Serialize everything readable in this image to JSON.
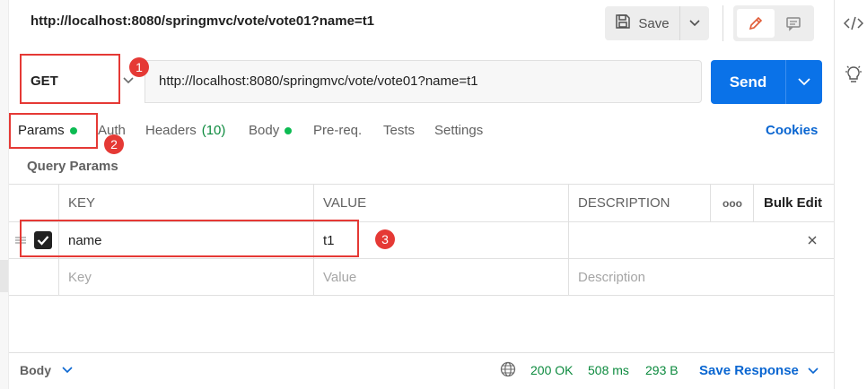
{
  "header": {
    "url_title": "http://localhost:8080/springmvc/vote/vote01?name=t1",
    "save_label": "Save"
  },
  "request": {
    "method": "GET",
    "url": "http://localhost:8080/springmvc/vote/vote01?name=t1",
    "send_label": "Send"
  },
  "tabs": {
    "params": "Params",
    "auth": "Auth",
    "headers": "Headers",
    "headers_count": "(10)",
    "body": "Body",
    "prereq": "Pre-req.",
    "tests": "Tests",
    "settings": "Settings",
    "cookies": "Cookies"
  },
  "query_params": {
    "title": "Query Params",
    "columns": {
      "key": "KEY",
      "value": "VALUE",
      "description": "DESCRIPTION",
      "more": "ooo",
      "bulk_edit": "Bulk Edit"
    },
    "rows": [
      {
        "key": "name",
        "value": "t1",
        "description": "",
        "checked": true
      }
    ],
    "placeholders": {
      "key": "Key",
      "value": "Value",
      "description": "Description"
    }
  },
  "response": {
    "body_label": "Body",
    "status": "200 OK",
    "time": "508 ms",
    "size": "293 B",
    "save_response": "Save Response"
  },
  "annotations": {
    "badge1": "1",
    "badge2": "2",
    "badge3": "3"
  },
  "colors": {
    "send_blue": "#0a72e8",
    "link_blue": "#0a66d1",
    "status_green": "#0c8a3e",
    "annotation_red": "#e53935"
  },
  "icons": [
    "code-icon",
    "lightbulb-icon",
    "save-icon",
    "chevron-down-icon",
    "pencil-icon",
    "comment-icon",
    "checkbox-icon",
    "drag-handle-icon",
    "close-icon",
    "globe-icon"
  ]
}
